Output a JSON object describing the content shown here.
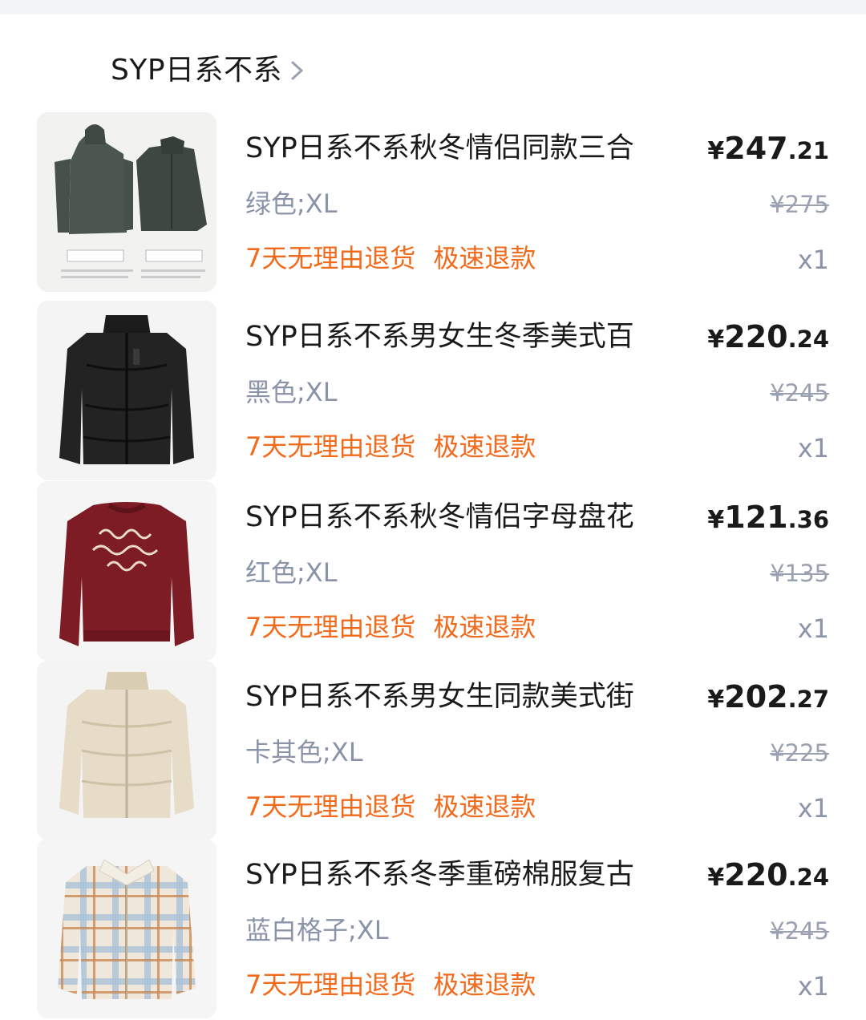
{
  "shop": {
    "name": "SYP日系不系"
  },
  "items": [
    {
      "title": "SYP日系不系秋冬情侣同款三合",
      "price_symbol": "¥",
      "price_int": "247",
      "price_dec": ".21",
      "spec": "绿色;XL",
      "orig_price": "¥275",
      "service_1": "7天无理由退货",
      "service_2": "极速退款",
      "qty": "x1"
    },
    {
      "title": "SYP日系不系男女生冬季美式百",
      "price_symbol": "¥",
      "price_int": "220",
      "price_dec": ".24",
      "spec": "黑色;XL",
      "orig_price": "¥245",
      "service_1": "7天无理由退货",
      "service_2": "极速退款",
      "qty": "x1"
    },
    {
      "title": "SYP日系不系秋冬情侣字母盘花",
      "price_symbol": "¥",
      "price_int": "121",
      "price_dec": ".36",
      "spec": "红色;XL",
      "orig_price": "¥135",
      "service_1": "7天无理由退货",
      "service_2": "极速退款",
      "qty": "x1"
    },
    {
      "title": "SYP日系不系男女生同款美式街",
      "price_symbol": "¥",
      "price_int": "202",
      "price_dec": ".27",
      "spec": "卡其色;XL",
      "orig_price": "¥225",
      "service_1": "7天无理由退货",
      "service_2": "极速退款",
      "qty": "x1"
    },
    {
      "title": "SYP日系不系冬季重磅棉服复古",
      "price_symbol": "¥",
      "price_int": "220",
      "price_dec": ".24",
      "spec": "蓝白格子;XL",
      "orig_price": "¥245",
      "service_1": "7天无理由退货",
      "service_2": "极速退款",
      "qty": "x1"
    }
  ],
  "colors": {
    "service": "#f26a1b",
    "spec": "#8a93a8",
    "title": "#1a1a1a"
  },
  "icons": {
    "shop_chevron": "chevron-right-icon"
  }
}
